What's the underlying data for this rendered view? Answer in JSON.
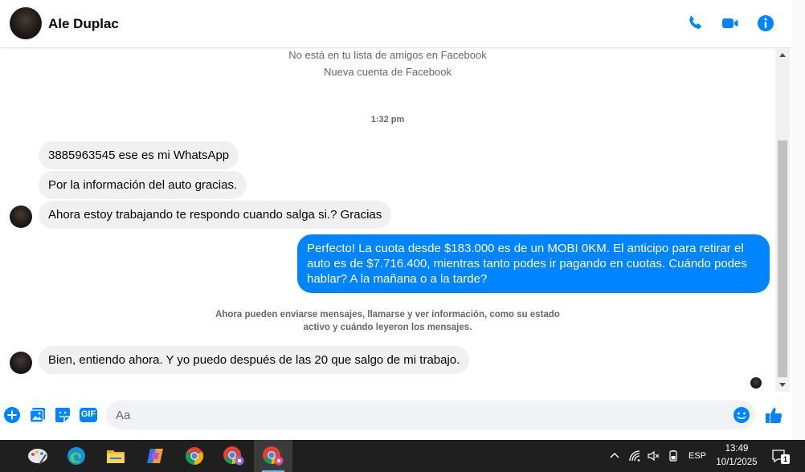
{
  "header": {
    "contact_name": "Ale Duplac",
    "icons": [
      "phone-icon",
      "video-icon",
      "info-icon"
    ]
  },
  "conversation": {
    "system_notice_1": "No está en tu lista de amigos en Facebook",
    "system_notice_2": "Nueva cuenta de Facebook",
    "timestamp": "1:32 pm",
    "msg_1": "3885963545 ese es mi WhatsApp",
    "msg_2": "Por la información del auto gracias.",
    "msg_3": "Ahora estoy trabajando te respondo cuando salga si.? Gracias",
    "msg_4": "Perfecto! La cuota desde $183.000 es de un MOBI 0KM. El anticipo para retirar el auto es de $7.716.400, mientras tanto podes ir pagando en cuotas. Cuándo podes hablar? A la mañana o a la tarde?",
    "system_notice_3_line1": "Ahora pueden enviarse mensajes, llamarse y ver información, como su estado",
    "system_notice_3_line2": "activo y cuándo leyeron los mensajes.",
    "msg_5": "Bien, entiendo ahora. Y yo puedo después de las 20 que salgo de mi trabajo."
  },
  "composer": {
    "placeholder": "Aa",
    "gif_label": "GIF"
  },
  "colors": {
    "messenger_blue": "#0084ff",
    "incoming_bubble": "#f0f0f0",
    "taskbar": "#1f1f1f"
  },
  "taskbar": {
    "language": "ESP",
    "time": "13:49",
    "date": "10/1/2025",
    "notification_count": "1",
    "apps": [
      "paint-app",
      "edge-app",
      "file-explorer-app",
      "copilot-app",
      "chrome-app",
      "chrome-profile-app",
      "chrome-profile-active-app"
    ]
  }
}
